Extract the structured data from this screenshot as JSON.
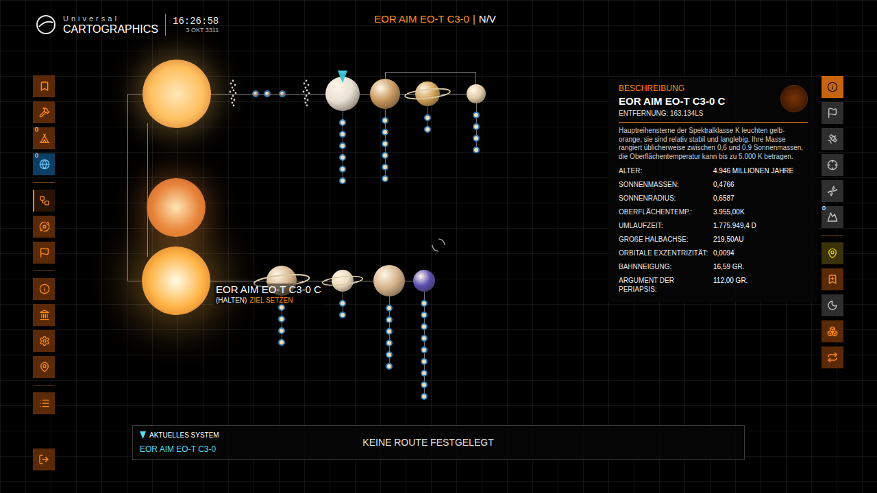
{
  "header": {
    "brand_top": "Universal",
    "brand": "CARTOGRAPHICS",
    "time": "16:26:58",
    "date": "3 OKT 3311"
  },
  "title": {
    "system": "EOR AIM EO-T C3-0",
    "separator": "|",
    "status": "N/V"
  },
  "left_toolbar": {
    "groups": [
      [
        {
          "selected": false,
          "marked": false
        },
        {
          "selected": false,
          "marked": false
        },
        {
          "selected": false,
          "marked": false,
          "badge": "0"
        },
        {
          "selected": false,
          "marked": true,
          "badge": "0"
        }
      ],
      [
        {
          "selected": true,
          "marked": false
        },
        {
          "selected": false,
          "marked": false
        },
        {
          "selected": false,
          "marked": false
        }
      ],
      [
        {
          "selected": false,
          "marked": false
        },
        {
          "selected": false,
          "marked": false
        },
        {
          "selected": false,
          "marked": false
        },
        {
          "selected": false,
          "marked": false
        }
      ],
      [
        {
          "selected": false,
          "marked": false
        }
      ]
    ],
    "exit": {
      "selected": false
    }
  },
  "right_toolbar": {
    "groups": [
      [
        {
          "selected": true,
          "on": true,
          "marked": false
        },
        {
          "selected": false,
          "on": false,
          "marked": false
        },
        {
          "selected": false,
          "on": false,
          "marked": false
        },
        {
          "selected": false,
          "on": false,
          "marked": false
        },
        {
          "selected": false,
          "on": false,
          "marked": false
        },
        {
          "selected": false,
          "on": false,
          "marked": false,
          "badge": "0"
        }
      ],
      [
        {
          "selected": false,
          "on": false,
          "marked": true
        },
        {
          "selected": false,
          "on": true,
          "marked": false
        },
        {
          "selected": false,
          "on": false,
          "marked": false
        },
        {
          "selected": false,
          "on": true,
          "marked": false
        },
        {
          "selected": false,
          "on": true,
          "marked": false
        }
      ]
    ]
  },
  "map": {
    "stars": [
      {
        "selected": false,
        "color": "#ffbf5e",
        "children": [
          {
            "kind": "belt"
          },
          {
            "kind": "planet",
            "color": "#d89a72",
            "rings": false,
            "current": false,
            "moons": 0
          },
          {
            "kind": "planet",
            "color": "#e2b48a",
            "rings": false,
            "current": false,
            "moons": 0
          },
          {
            "kind": "planet",
            "color": "#d0966c",
            "rings": false,
            "current": false,
            "moons": 0
          },
          {
            "kind": "belt"
          },
          {
            "kind": "planet",
            "color": "#e9e0d4",
            "rings": false,
            "current": true,
            "moons": 6
          },
          {
            "kind": "planet",
            "color": "#c9985e",
            "rings": false,
            "current": false,
            "moons": 6
          },
          {
            "kind": "planet",
            "color": "#d4a55a",
            "rings": true,
            "current": false,
            "moons": 2
          },
          {
            "kind": "planet",
            "color": "#e0cba8",
            "rings": false,
            "current": false,
            "moons": 4
          }
        ]
      },
      {
        "selected": false,
        "color": "#e8843c",
        "children": []
      },
      {
        "selected": true,
        "color": "#ffb446",
        "label": "EOR AIM EO-T C3-0 C",
        "hint": "(HALTEN)",
        "action": "ZIEL SETZEN",
        "children": [
          {
            "kind": "planet",
            "color": "#d8b890",
            "rings": true,
            "current": false,
            "moons": 4
          },
          {
            "kind": "planet",
            "color": "#ecdcc0",
            "rings": true,
            "current": false,
            "moons": 2
          },
          {
            "kind": "planet",
            "color": "#d6b48c",
            "rings": false,
            "current": false,
            "moons": 6
          },
          {
            "kind": "planet",
            "color": "#5a4fb0",
            "rings": false,
            "current": false,
            "moons": 9
          }
        ]
      }
    ]
  },
  "description": {
    "heading": "BESCHREIBUNG",
    "name": "EOR AIM EO-T C3-0 C",
    "distance": "ENTFERNUNG: 163.134LS",
    "text": "Hauptreihensterne der Spektralklasse K leuchten gelb-orange, sie sind relativ stabil und langlebig. Ihre Masse rangiert üblicherweise zwischen 0,6 und 0,9 Sonnenmassen, die Oberflächentemperatur kann bis zu 5.000 K betragen.",
    "properties": [
      {
        "label": "ALTER:",
        "value": "4.946 MILLIONEN JAHRE"
      },
      {
        "label": "SONNENMASSEN:",
        "value": "0,4766"
      },
      {
        "label": "SONNENRADIUS:",
        "value": "0,6587"
      },
      {
        "label": "OBERFLÄCHENTEMP.:",
        "value": "3.955,00K"
      },
      {
        "label": "UMLAUFZEIT:",
        "value": "1.775.949,4 D"
      },
      {
        "label": "GROßE HALBACHSE:",
        "value": "219,50AU"
      },
      {
        "label": "ORBITALE EXZENTRIZITÄT:",
        "value": "0,0094"
      },
      {
        "label": "BAHNNEIGUNG:",
        "value": "16,59 GR."
      },
      {
        "label": "ARGUMENT DER PERIAPSIS:",
        "value": "112,00 GR."
      }
    ]
  },
  "route_bar": {
    "current_label": "AKTUELLES SYSTEM",
    "current_system": "EOR AIM EO-T C3-0",
    "route": "KEINE ROUTE FESTGELEGT"
  }
}
